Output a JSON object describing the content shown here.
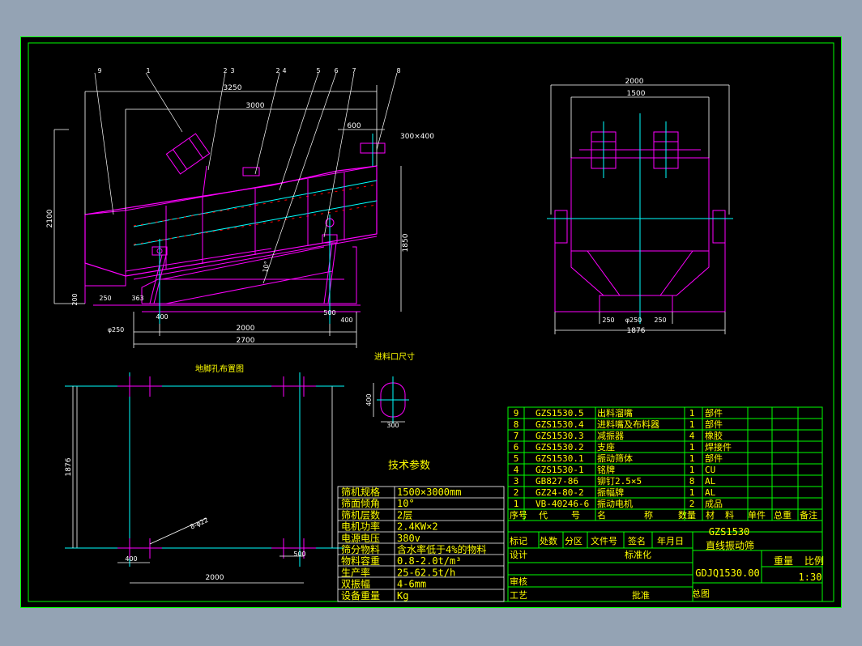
{
  "colors": {
    "background": "#94a3b4",
    "paper": "#000000",
    "frame": "#00ff00",
    "part": "#ff00ff",
    "dimension": "#ffffff",
    "centerline": "#00ffff",
    "text": "#ffff00",
    "hidden": "#ff0000"
  },
  "side_view": {
    "dims_top": [
      "3250",
      "3000",
      "600",
      "300×400"
    ],
    "dims_left": [
      "2100",
      "200",
      "φ250"
    ],
    "dims_bottom": [
      "250",
      "363",
      "400",
      "2000",
      "500",
      "400",
      "2700"
    ],
    "dims_right": [
      "1850"
    ],
    "angle": "10°",
    "balloons": [
      "9",
      "1",
      "2",
      "3",
      "2",
      "4",
      "5",
      "6",
      "7",
      "8"
    ]
  },
  "end_view": {
    "dims_top": [
      "2000",
      "1500"
    ],
    "dims_bottom": [
      "250",
      "φ250",
      "250",
      "1876"
    ]
  },
  "foundation": {
    "title": "地脚孔布置图",
    "dims": [
      "1876",
      "400",
      "500",
      "2000"
    ],
    "holes_label": "8-φ22"
  },
  "inlet": {
    "title": "进料口尺寸",
    "width": "300",
    "height": "400"
  },
  "tech_params": {
    "title": "技术参数",
    "rows": [
      {
        "label": "筛机规格",
        "value": "1500×3000mm"
      },
      {
        "label": "筛面倾角",
        "value": "10°"
      },
      {
        "label": "筛机层数",
        "value": "2层"
      },
      {
        "label": "电机功率",
        "value": "2.4KW×2"
      },
      {
        "label": "电源电压",
        "value": "380v"
      },
      {
        "label": "筛分物料",
        "value": "含水率低于4%的物料"
      },
      {
        "label": "物料容重",
        "value": "0.8-2.0t/m³"
      },
      {
        "label": "生产率",
        "value": "25-62.5t/h"
      },
      {
        "label": "双振幅",
        "value": "4-6mm"
      },
      {
        "label": "设备重量",
        "value": "Kg"
      }
    ]
  },
  "bom": {
    "rows": [
      {
        "no": "9",
        "code": "GZS1530.5",
        "name": "出料溜嘴",
        "qty": "1",
        "material": "部件"
      },
      {
        "no": "8",
        "code": "GZS1530.4",
        "name": "进料嘴及布料器",
        "qty": "1",
        "material": "部件"
      },
      {
        "no": "7",
        "code": "GZS1530.3",
        "name": "减振器",
        "qty": "4",
        "material": "橡胶"
      },
      {
        "no": "6",
        "code": "GZS1530.2",
        "name": "支座",
        "qty": "1",
        "material": "焊接件"
      },
      {
        "no": "5",
        "code": "GZS1530.1",
        "name": "振动筛体",
        "qty": "1",
        "material": "部件"
      },
      {
        "no": "4",
        "code": "GZS1530-1",
        "name": "铭牌",
        "qty": "1",
        "material": "CU"
      },
      {
        "no": "3",
        "code": "GB827-86",
        "name": "铆钉2.5×5",
        "qty": "8",
        "material": "AL"
      },
      {
        "no": "2",
        "code": "GZ24-80-2",
        "name": "振幅牌",
        "qty": "1",
        "material": "AL"
      },
      {
        "no": "1",
        "code": "VB-40246-6",
        "name": "振动电机",
        "qty": "2",
        "material": "成品"
      }
    ],
    "headers": [
      "序号",
      "代",
      "号",
      "名",
      "称",
      "数量",
      "材",
      "料",
      "单件",
      "总重",
      "备注"
    ]
  },
  "title_block": {
    "row1": [
      "标记",
      "处数",
      "分区",
      "文件号",
      "签名",
      "年月日"
    ],
    "design": "设计",
    "standard": "标准化",
    "review": "审核",
    "process": "工艺",
    "approve": "批准",
    "model": "GZS1530",
    "name": "直线振动筛",
    "drawing_no": "GDJQ1530.00",
    "weight_label": "重量",
    "scale_label": "比例",
    "scale": "1:30",
    "assembly": "总图"
  }
}
